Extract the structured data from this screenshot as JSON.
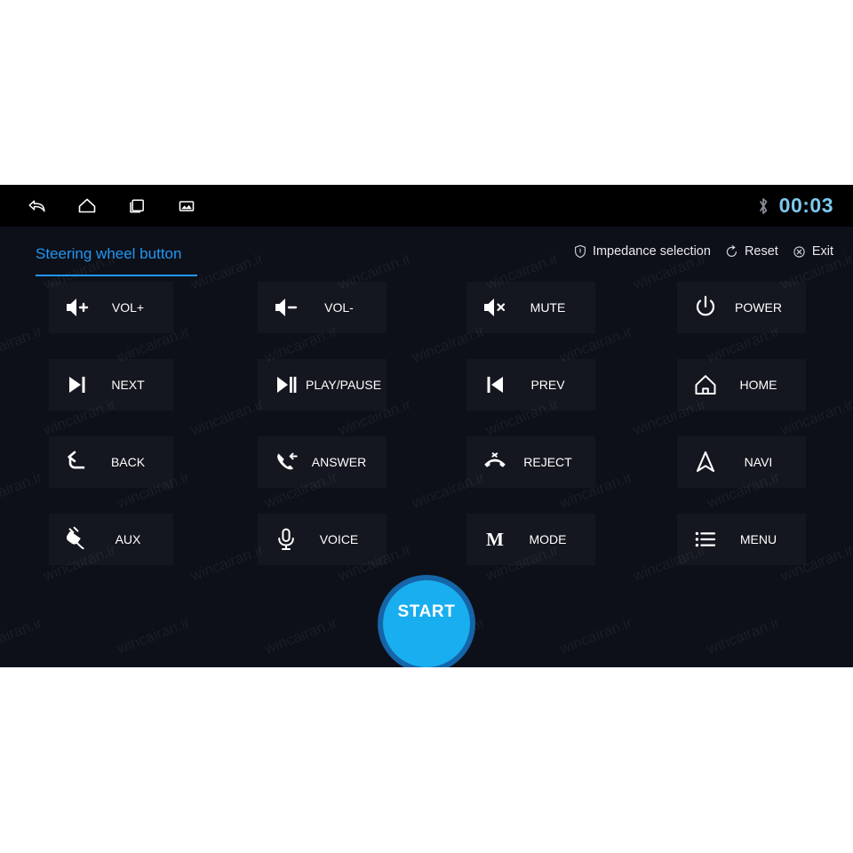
{
  "statusbar": {
    "nav_icons": [
      {
        "name": "back-icon",
        "label": "Back"
      },
      {
        "name": "home-icon",
        "label": "Home"
      },
      {
        "name": "recents-icon",
        "label": "Recents"
      },
      {
        "name": "screenshot-icon",
        "label": "Screenshot"
      }
    ],
    "bluetooth_icon": "bluetooth-icon",
    "clock": "00:03",
    "clock_color": "#7ec8ef",
    "background": "#000000"
  },
  "header": {
    "tab_label": "Steering wheel button",
    "tab_accent": "#2196f3",
    "actions": [
      {
        "label": "Impedance selection",
        "icon": "shield-icon"
      },
      {
        "label": "Reset",
        "icon": "reset-icon"
      },
      {
        "label": "Exit",
        "icon": "exit-icon"
      }
    ]
  },
  "grid": {
    "buttons": [
      {
        "label": "VOL+",
        "icon": "volume-up-icon"
      },
      {
        "label": "VOL-",
        "icon": "volume-down-icon"
      },
      {
        "label": "MUTE",
        "icon": "volume-mute-icon"
      },
      {
        "label": "POWER",
        "icon": "power-icon"
      },
      {
        "label": "NEXT",
        "icon": "skip-next-icon"
      },
      {
        "label": "PLAY/PAUSE",
        "icon": "play-pause-icon"
      },
      {
        "label": "PREV",
        "icon": "skip-previous-icon"
      },
      {
        "label": "HOME",
        "icon": "home-icon"
      },
      {
        "label": "BACK",
        "icon": "back-arrow-icon"
      },
      {
        "label": "ANSWER",
        "icon": "phone-answer-icon"
      },
      {
        "label": "REJECT",
        "icon": "phone-reject-icon"
      },
      {
        "label": "NAVI",
        "icon": "navigation-arrow-icon"
      },
      {
        "label": "AUX",
        "icon": "plug-icon"
      },
      {
        "label": "VOICE",
        "icon": "microphone-icon"
      },
      {
        "label": "MODE",
        "icon": "mode-m-icon",
        "glyph": "M"
      },
      {
        "label": "MENU",
        "icon": "list-menu-icon"
      }
    ]
  },
  "start_button": {
    "label": "START",
    "fill_color": "#18aeef",
    "ring_color": "#1565a8"
  },
  "watermark": {
    "text": "wincairan.ir"
  },
  "theme": {
    "panel_background": "#0d1018",
    "tile_background": "rgba(255,255,255,0.03)",
    "text_color": "#ffffff"
  }
}
